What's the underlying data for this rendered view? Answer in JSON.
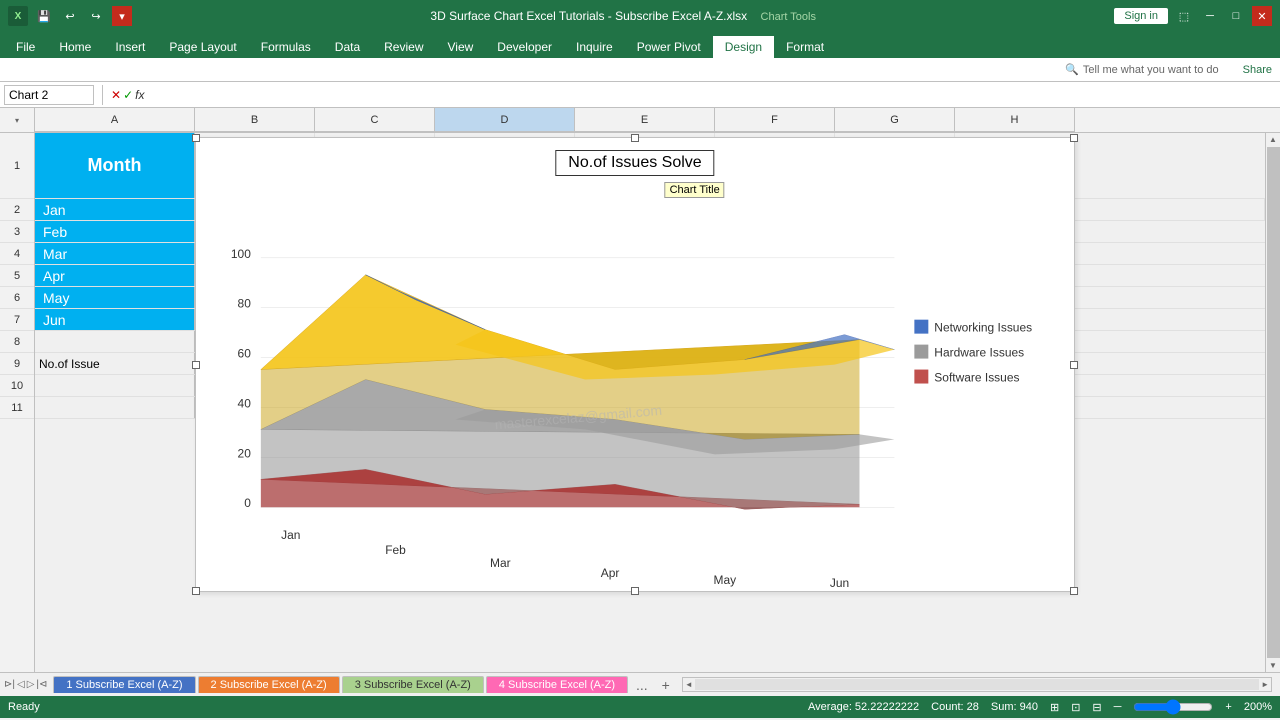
{
  "titleBar": {
    "appIcon": "X",
    "undoLabel": "↩",
    "redoLabel": "↪",
    "saveLabel": "💾",
    "fileName": "3D Surface Chart Excel Tutorials - Subscribe Excel A-Z.xlsx",
    "appName": "Excel",
    "chartToolsLabel": "Chart Tools",
    "signInLabel": "Sign in",
    "shareLabel": "Share"
  },
  "ribbonTabs": [
    {
      "label": "File",
      "active": false
    },
    {
      "label": "Home",
      "active": false
    },
    {
      "label": "Insert",
      "active": false
    },
    {
      "label": "Page Layout",
      "active": false
    },
    {
      "label": "Formulas",
      "active": false
    },
    {
      "label": "Data",
      "active": false
    },
    {
      "label": "Review",
      "active": false
    },
    {
      "label": "View",
      "active": false
    },
    {
      "label": "Developer",
      "active": false
    },
    {
      "label": "Inquire",
      "active": false
    },
    {
      "label": "Power Pivot",
      "active": false
    },
    {
      "label": "Design",
      "active": true
    },
    {
      "label": "Format",
      "active": false
    }
  ],
  "formulaBar": {
    "nameBox": "Chart 2",
    "cancelIcon": "✕",
    "confirmIcon": "✓",
    "functionIcon": "fx"
  },
  "columns": [
    "A",
    "B",
    "C",
    "D",
    "E",
    "F",
    "G",
    "H"
  ],
  "rows": [
    {
      "rowNum": 1,
      "cells": [
        "Month",
        "",
        "",
        "",
        "",
        "",
        "",
        ""
      ]
    },
    {
      "rowNum": 2,
      "cells": [
        "Jan",
        "",
        "",
        "",
        "",
        "",
        "",
        ""
      ]
    },
    {
      "rowNum": 3,
      "cells": [
        "Feb",
        "",
        "",
        "",
        "",
        "",
        "",
        ""
      ]
    },
    {
      "rowNum": 4,
      "cells": [
        "Mar",
        "",
        "",
        "",
        "",
        "",
        "",
        ""
      ]
    },
    {
      "rowNum": 5,
      "cells": [
        "Apr",
        "",
        "",
        "",
        "",
        "",
        "",
        ""
      ]
    },
    {
      "rowNum": 6,
      "cells": [
        "May",
        "",
        "",
        "",
        "",
        "",
        "",
        ""
      ]
    },
    {
      "rowNum": 7,
      "cells": [
        "Jun",
        "",
        "",
        "",
        "",
        "",
        "",
        ""
      ]
    },
    {
      "rowNum": 8,
      "cells": [
        "",
        "",
        "",
        "",
        "",
        "",
        "",
        ""
      ]
    },
    {
      "rowNum": 9,
      "cells": [
        "No.of Issue",
        "",
        "",
        "",
        "",
        "",
        "",
        ""
      ]
    },
    {
      "rowNum": 10,
      "cells": [
        "",
        "",
        "",
        "",
        "",
        "",
        "",
        ""
      ]
    },
    {
      "rowNum": 11,
      "cells": [
        "",
        "",
        "",
        "",
        "",
        "",
        "",
        ""
      ]
    }
  ],
  "chart": {
    "title": "No.of Issues Solve",
    "titleTooltip": "Chart Title",
    "yAxisLabels": [
      "0",
      "20",
      "40",
      "60",
      "80",
      "100"
    ],
    "xAxisLabels": [
      "Jan",
      "Feb",
      "Mar",
      "Apr",
      "May",
      "Jun"
    ],
    "legendItems": [
      "Networking Issues",
      "Hardware Issues",
      "Software Issues"
    ],
    "watermark": "masterexcelaz@gmail.com"
  },
  "sheetTabs": [
    {
      "label": "1 Subscribe Excel (A-Z)",
      "color": "#4472C4"
    },
    {
      "label": "2 Subscribe Excel (A-Z)",
      "color": "#ED7D31"
    },
    {
      "label": "3 Subscribe Excel (A-Z)",
      "color": "#A9D18E"
    },
    {
      "label": "4 Subscribe Excel (A-Z)",
      "color": "#FF69B4"
    }
  ],
  "statusBar": {
    "readyLabel": "Ready",
    "averageLabel": "Average: 52.22222222",
    "countLabel": "Count: 28",
    "sumLabel": "Sum: 940",
    "zoomLevel": "200%"
  }
}
